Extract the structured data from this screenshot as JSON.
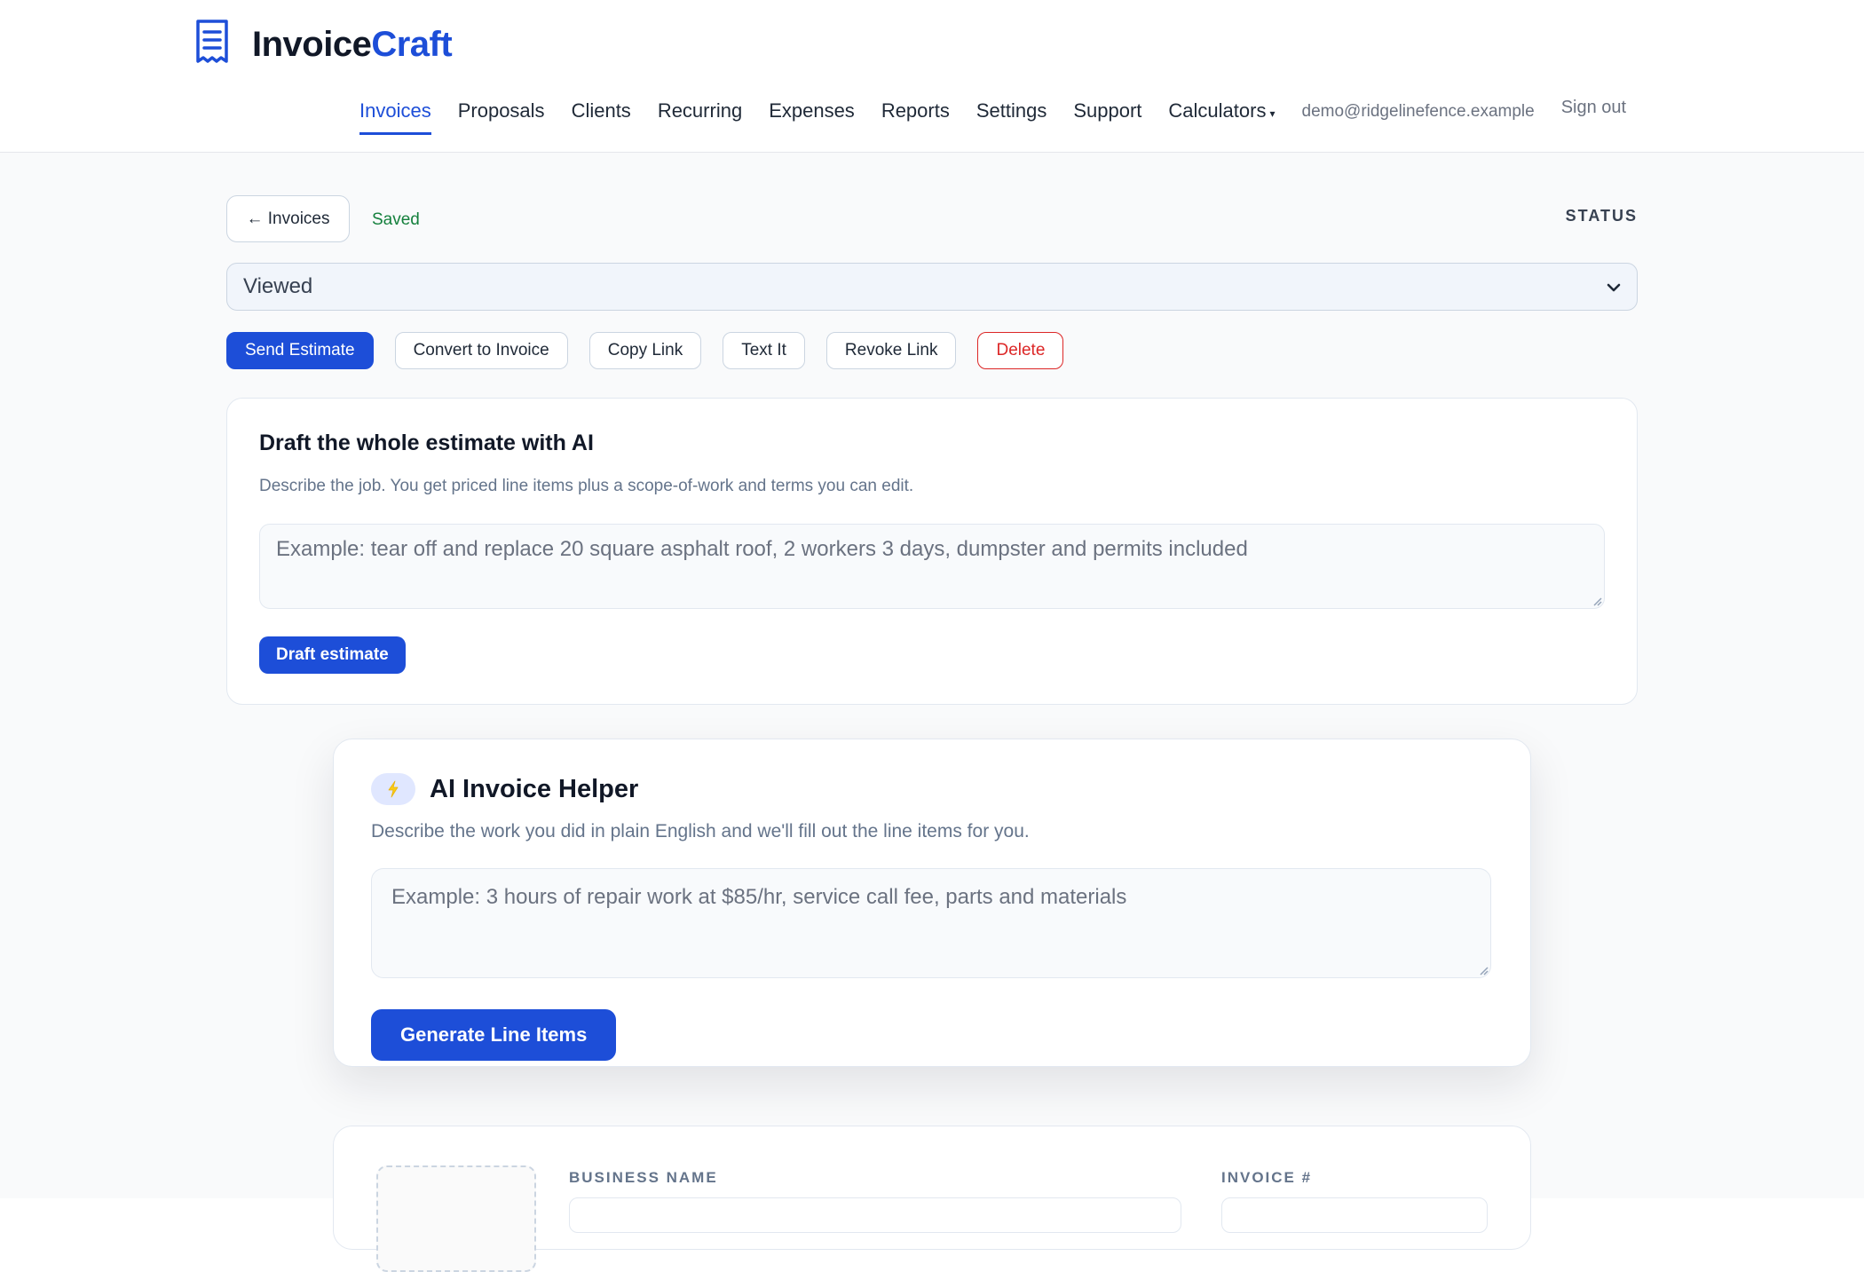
{
  "brand": {
    "name_part1": "Invoice",
    "name_part2": "Craft",
    "logo_icon": "receipt-icon",
    "accent": "#1d4ed8"
  },
  "nav": {
    "items": [
      {
        "label": "Invoices",
        "active": true
      },
      {
        "label": "Proposals"
      },
      {
        "label": "Clients"
      },
      {
        "label": "Recurring"
      },
      {
        "label": "Expenses"
      },
      {
        "label": "Reports"
      },
      {
        "label": "Settings"
      },
      {
        "label": "Support"
      },
      {
        "label": "Calculators"
      }
    ],
    "calculators_caret": "▾",
    "email": "demo@ridgelinefence.example",
    "sign_out": "Sign out"
  },
  "toolbar": {
    "back_label": "← Invoices",
    "saved_text": "Saved",
    "status_label": "STATUS",
    "status_value": "Viewed"
  },
  "actions": {
    "send_estimate": "Send Estimate",
    "convert_to_invoice": "Convert to Invoice",
    "copy_link": "Copy Link",
    "text_it": "Text It",
    "revoke_link": "Revoke Link",
    "delete": "Delete"
  },
  "ai_draft": {
    "title": "Draft the whole estimate with AI",
    "description": "Describe the job. You get priced line items plus a scope-of-work and terms you can edit.",
    "placeholder": "Example: tear off and replace 20 square asphalt roof, 2 workers 3 days, dumpster and permits included",
    "button": "Draft estimate"
  },
  "ai_helper": {
    "icon": "lightning-bolt-icon",
    "title": "AI Invoice Helper",
    "description": "Describe the work you did in plain English and we'll fill out the line items for you.",
    "placeholder": "Example: 3 hours of repair work at $85/hr, service call fee, parts and materials",
    "button": "Generate Line Items"
  },
  "invoice_form": {
    "business_name_label": "BUSINESS NAME",
    "invoice_number_label": "INVOICE #"
  },
  "colors": {
    "primary": "#1d4ed8",
    "saved_green": "#15803d",
    "danger": "#dc2626",
    "muted": "#64748b"
  }
}
